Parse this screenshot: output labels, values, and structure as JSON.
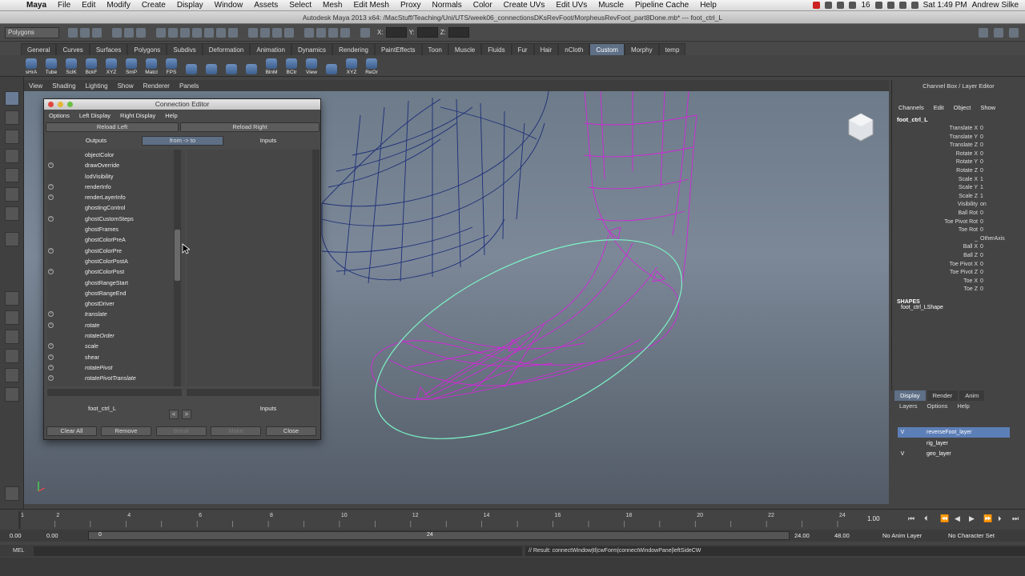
{
  "menubar": {
    "app": "Maya",
    "items": [
      "File",
      "Edit",
      "Modify",
      "Create",
      "Display",
      "Window",
      "Assets",
      "Select",
      "Mesh",
      "Edit Mesh",
      "Proxy",
      "Normals",
      "Color",
      "Create UVs",
      "Edit UVs",
      "Muscle",
      "Pipeline Cache",
      "Help"
    ],
    "battery": "16",
    "clock": "Sat 1:49 PM",
    "user": "Andrew Silke"
  },
  "window_title": "Autodesk Maya 2013 x64: /MacStuff/Teaching/Uni/UTS/week06_connectionsDKsRevFoot/MorpheusRevFoot_part8Done.mb*  ---  foot_ctrl_L",
  "status_line": {
    "mode": "Polygons",
    "x_label": "X:",
    "y_label": "Y:",
    "z_label": "Z:"
  },
  "shelf_tabs": [
    "General",
    "Curves",
    "Surfaces",
    "Polygons",
    "Subdivs",
    "Deformation",
    "Animation",
    "Dynamics",
    "Rendering",
    "PaintEffects",
    "Toon",
    "Muscle",
    "Fluids",
    "Fur",
    "Hair",
    "nCloth",
    "Custom",
    "Morphy",
    "temp"
  ],
  "shelf_active": "Custom",
  "shelf_tools": [
    "sHrA",
    "Tube",
    "SclK",
    "BckF",
    "XYZ",
    "SmP",
    "Matcl",
    "FPS",
    "",
    "",
    "",
    "",
    "BlnM",
    "BCtr",
    "View",
    "",
    "XYZ",
    "ReOr"
  ],
  "viewport_menu": [
    "View",
    "Shading",
    "Lighting",
    "Show",
    "Renderer",
    "Panels"
  ],
  "connection_editor": {
    "title": "Connection Editor",
    "menu": [
      "Options",
      "Left Display",
      "Right Display",
      "Help"
    ],
    "reload_left": "Reload Left",
    "reload_right": "Reload Right",
    "outputs_label": "Outputs",
    "direction": "from -> to",
    "inputs_label": "Inputs",
    "left_items": [
      {
        "name": "objectColor",
        "expand": false,
        "italic": false
      },
      {
        "name": "drawOverride",
        "expand": true,
        "italic": false
      },
      {
        "name": "lodVisibility",
        "expand": false,
        "italic": false
      },
      {
        "name": "renderInfo",
        "expand": true,
        "italic": false
      },
      {
        "name": "renderLayerInfo",
        "expand": true,
        "italic": false
      },
      {
        "name": "ghostingControl",
        "expand": false,
        "italic": false
      },
      {
        "name": "ghostCustomSteps",
        "expand": true,
        "italic": false
      },
      {
        "name": "ghostFrames",
        "expand": false,
        "italic": false
      },
      {
        "name": "ghostColorPreA",
        "expand": false,
        "italic": false
      },
      {
        "name": "ghostColorPre",
        "expand": true,
        "italic": false
      },
      {
        "name": "ghostColorPostA",
        "expand": false,
        "italic": false
      },
      {
        "name": "ghostColorPost",
        "expand": true,
        "italic": false
      },
      {
        "name": "ghostRangeStart",
        "expand": false,
        "italic": false
      },
      {
        "name": "ghostRangeEnd",
        "expand": false,
        "italic": false
      },
      {
        "name": "ghostDriver",
        "expand": false,
        "italic": false
      },
      {
        "name": "translate",
        "expand": true,
        "italic": true
      },
      {
        "name": "rotate",
        "expand": true,
        "italic": true
      },
      {
        "name": "rotateOrder",
        "expand": false,
        "italic": true
      },
      {
        "name": "scale",
        "expand": true,
        "italic": true
      },
      {
        "name": "shear",
        "expand": true,
        "italic": false
      },
      {
        "name": "rotatePivot",
        "expand": true,
        "italic": true
      },
      {
        "name": "rotatePivotTranslate",
        "expand": true,
        "italic": true
      }
    ],
    "left_node": "foot_ctrl_L",
    "right_node": "Inputs",
    "buttons": {
      "clear_all": "Clear All",
      "remove": "Remove",
      "break": "Break",
      "make": "Make",
      "close": "Close"
    }
  },
  "channel_box": {
    "title": "Channel Box / Layer Editor",
    "menu": [
      "Channels",
      "Edit",
      "Object",
      "Show"
    ],
    "object": "foot_ctrl_L",
    "attributes": [
      {
        "name": "Translate X",
        "value": "0"
      },
      {
        "name": "Translate Y",
        "value": "0"
      },
      {
        "name": "Translate Z",
        "value": "0"
      },
      {
        "name": "Rotate X",
        "value": "0"
      },
      {
        "name": "Rotate Y",
        "value": "0"
      },
      {
        "name": "Rotate Z",
        "value": "0"
      },
      {
        "name": "Scale X",
        "value": "1"
      },
      {
        "name": "Scale Y",
        "value": "1"
      },
      {
        "name": "Scale Z",
        "value": "1"
      },
      {
        "name": "Visibility",
        "value": "on"
      },
      {
        "name": "Ball Rot",
        "value": "0"
      },
      {
        "name": "Toe Pivot Rot",
        "value": "0"
      },
      {
        "name": "Toe Rot",
        "value": "0"
      },
      {
        "name": "_",
        "value": "OtherAxis"
      },
      {
        "name": "Ball X",
        "value": "0"
      },
      {
        "name": "Ball Z",
        "value": "0"
      },
      {
        "name": "Toe Pivot X",
        "value": "0"
      },
      {
        "name": "Toe Pivot Z",
        "value": "0"
      },
      {
        "name": "Toe X",
        "value": "0"
      },
      {
        "name": "Toe Z",
        "value": "0"
      }
    ],
    "shapes_label": "SHAPES",
    "shape": "foot_ctrl_LShape"
  },
  "layer_editor": {
    "tabs": [
      "Display",
      "Render",
      "Anim"
    ],
    "menu": [
      "Layers",
      "Options",
      "Help"
    ],
    "layers": [
      {
        "vis": "V",
        "name": "reverseFoot_layer",
        "selected": true
      },
      {
        "vis": "",
        "name": "rig_layer",
        "selected": false
      },
      {
        "vis": "V",
        "name": "geo_layer",
        "selected": false
      }
    ]
  },
  "time_slider": {
    "ticks": [
      "1",
      "2",
      "4",
      "6",
      "8",
      "10",
      "12",
      "14",
      "16",
      "18",
      "20",
      "22",
      "24"
    ],
    "current": "1.00"
  },
  "range_slider": {
    "start": "0.00",
    "playback_start": "0.00",
    "range_start": "0",
    "range_end": "24",
    "playback_end": "24.00",
    "end": "48.00",
    "anim_layer": "No Anim Layer",
    "character_set": "No Character Set"
  },
  "command_line": {
    "label": "MEL",
    "result": "// Result: connectWindow|tl|cwForm|connectWindowPane|leftSideCW"
  }
}
